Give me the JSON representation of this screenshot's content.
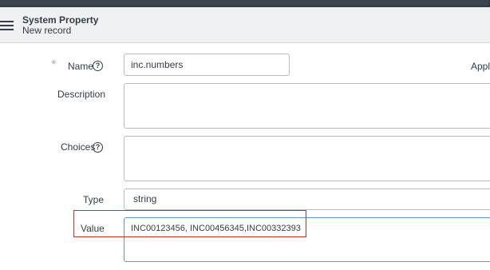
{
  "header": {
    "title": "System Property",
    "subtitle": "New record"
  },
  "form": {
    "name": {
      "label": "Name",
      "value": "inc.numbers",
      "required_marker": "*"
    },
    "description": {
      "label": "Description",
      "value": ""
    },
    "choices": {
      "label": "Choices",
      "value": ""
    },
    "type": {
      "label": "Type",
      "value": "string"
    },
    "value": {
      "label": "Value",
      "value": "INC00123456, INC00456345,INC00332393"
    },
    "help_glyph": "?",
    "side_label": "Appl"
  },
  "colors": {
    "topbar": "#2e3b45",
    "header_bg": "#f0f1f2",
    "highlight": "#c9302c",
    "focus_border": "#5b9bd5"
  }
}
